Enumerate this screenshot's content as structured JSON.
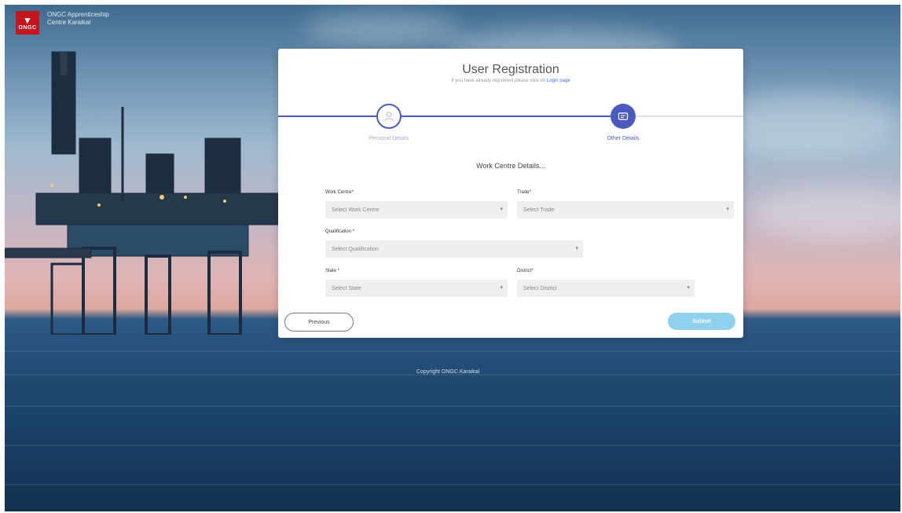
{
  "brand": {
    "logo_text": "ONGC",
    "name": "ONGC Apprenticeship Centre Karaikal"
  },
  "registration": {
    "title": "User Registration",
    "subtitle_prefix": "If you have already registered please click on",
    "login_link": "Login page",
    "steps": [
      {
        "label": "Personal Details",
        "icon": "user-icon",
        "state": "completed"
      },
      {
        "label": "Other Details",
        "icon": "id-card-icon",
        "state": "active"
      }
    ],
    "section_title": "Work Centre Details...",
    "fields": {
      "work_centre": {
        "label": "Work Centre",
        "placeholder": "Select Work Centre"
      },
      "trade": {
        "label": "Trade",
        "placeholder": "Select Trade"
      },
      "qualification": {
        "label": "Qualification",
        "placeholder": "Select Qualification"
      },
      "state": {
        "label": "State",
        "placeholder": "Select State"
      },
      "district": {
        "label": "District",
        "placeholder": "Select District"
      }
    },
    "previous_label": "Previous",
    "submit_label": "Submit"
  },
  "footer": {
    "copyright": "Copyright ONGC Karaikal"
  },
  "colors": {
    "accent": "#4b5bbd",
    "submit": "#8fd0ec",
    "brand_red": "#c4161c"
  }
}
